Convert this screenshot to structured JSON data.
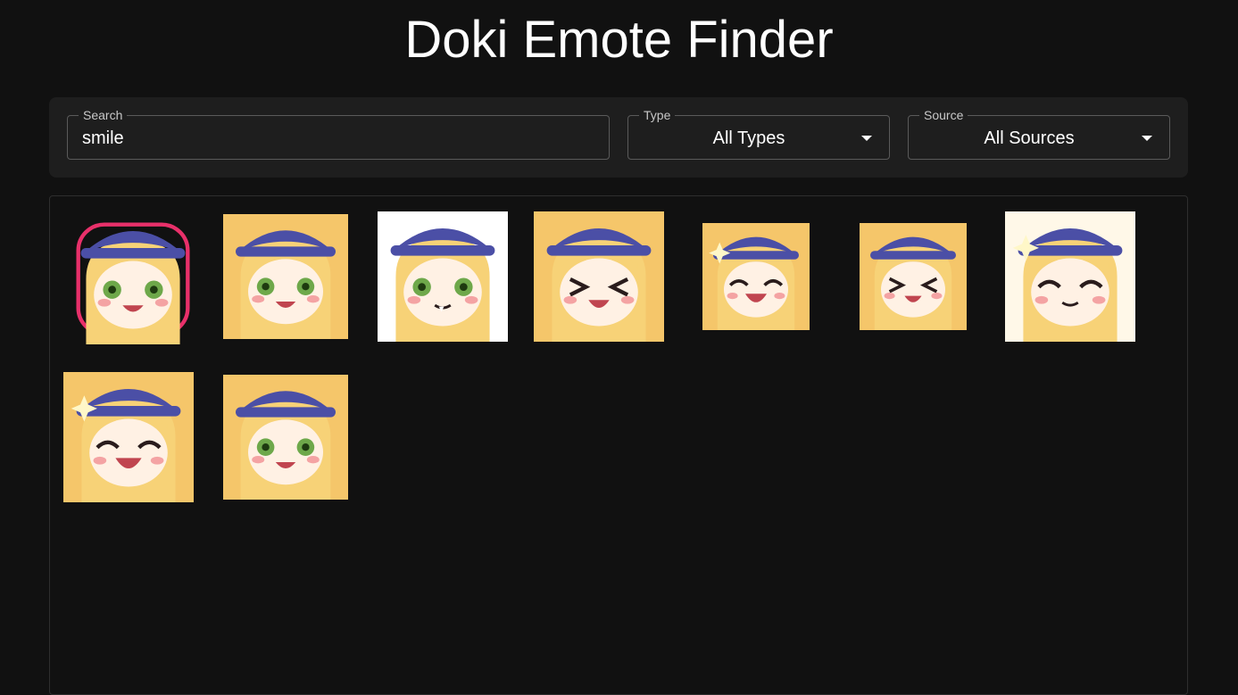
{
  "header": {
    "title": "Doki Emote Finder"
  },
  "filters": {
    "search": {
      "label": "Search",
      "value": "smile"
    },
    "type": {
      "label": "Type",
      "value": "All Types"
    },
    "source": {
      "label": "Source",
      "value": "All Sources"
    }
  },
  "emotes": [
    {
      "name": "chibi-smug-emote",
      "bg": "#111111",
      "style": "chibi"
    },
    {
      "name": "smile-emote",
      "bg": "#f5c66a",
      "style": "smile"
    },
    {
      "name": "fang-smile-emote",
      "bg": "#ffffff",
      "style": "fang"
    },
    {
      "name": "xd-laugh-emote",
      "bg": "#f5c66a",
      "style": "xd"
    },
    {
      "name": "sparkle-grin-emote",
      "bg": "#f5c66a",
      "style": "sparkle"
    },
    {
      "name": "xd-smile-emote",
      "bg": "#f5c66a",
      "style": "xd"
    },
    {
      "name": "content-smile-emote",
      "bg": "#fff8e8",
      "style": "content"
    },
    {
      "name": "happy-laugh-emote",
      "bg": "#f5c66a",
      "style": "sparkle"
    },
    {
      "name": "closed-smile-emote",
      "bg": "#f5c66a",
      "style": "smile"
    }
  ]
}
